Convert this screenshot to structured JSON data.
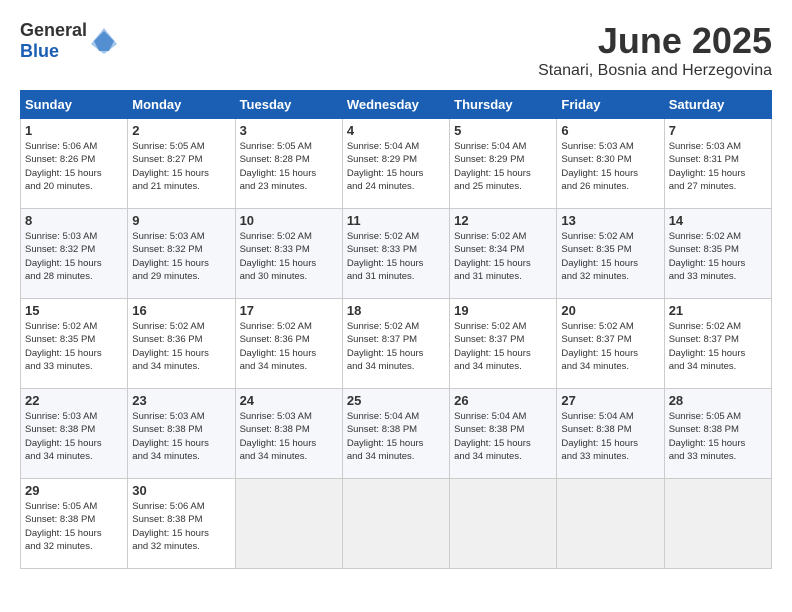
{
  "header": {
    "logo_general": "General",
    "logo_blue": "Blue",
    "title": "June 2025",
    "subtitle": "Stanari, Bosnia and Herzegovina"
  },
  "calendar": {
    "days_of_week": [
      "Sunday",
      "Monday",
      "Tuesday",
      "Wednesday",
      "Thursday",
      "Friday",
      "Saturday"
    ],
    "weeks": [
      [
        null,
        null,
        null,
        null,
        null,
        null,
        null
      ]
    ],
    "cells": [
      {
        "day": 1,
        "col": 0,
        "sunrise": "5:06 AM",
        "sunset": "8:26 PM",
        "daylight": "15 hours and 20 minutes."
      },
      {
        "day": 2,
        "col": 1,
        "sunrise": "5:05 AM",
        "sunset": "8:27 PM",
        "daylight": "15 hours and 21 minutes."
      },
      {
        "day": 3,
        "col": 2,
        "sunrise": "5:05 AM",
        "sunset": "8:28 PM",
        "daylight": "15 hours and 23 minutes."
      },
      {
        "day": 4,
        "col": 3,
        "sunrise": "5:04 AM",
        "sunset": "8:29 PM",
        "daylight": "15 hours and 24 minutes."
      },
      {
        "day": 5,
        "col": 4,
        "sunrise": "5:04 AM",
        "sunset": "8:29 PM",
        "daylight": "15 hours and 25 minutes."
      },
      {
        "day": 6,
        "col": 5,
        "sunrise": "5:03 AM",
        "sunset": "8:30 PM",
        "daylight": "15 hours and 26 minutes."
      },
      {
        "day": 7,
        "col": 6,
        "sunrise": "5:03 AM",
        "sunset": "8:31 PM",
        "daylight": "15 hours and 27 minutes."
      },
      {
        "day": 8,
        "col": 0,
        "sunrise": "5:03 AM",
        "sunset": "8:32 PM",
        "daylight": "15 hours and 28 minutes."
      },
      {
        "day": 9,
        "col": 1,
        "sunrise": "5:03 AM",
        "sunset": "8:32 PM",
        "daylight": "15 hours and 29 minutes."
      },
      {
        "day": 10,
        "col": 2,
        "sunrise": "5:02 AM",
        "sunset": "8:33 PM",
        "daylight": "15 hours and 30 minutes."
      },
      {
        "day": 11,
        "col": 3,
        "sunrise": "5:02 AM",
        "sunset": "8:33 PM",
        "daylight": "15 hours and 31 minutes."
      },
      {
        "day": 12,
        "col": 4,
        "sunrise": "5:02 AM",
        "sunset": "8:34 PM",
        "daylight": "15 hours and 31 minutes."
      },
      {
        "day": 13,
        "col": 5,
        "sunrise": "5:02 AM",
        "sunset": "8:35 PM",
        "daylight": "15 hours and 32 minutes."
      },
      {
        "day": 14,
        "col": 6,
        "sunrise": "5:02 AM",
        "sunset": "8:35 PM",
        "daylight": "15 hours and 33 minutes."
      },
      {
        "day": 15,
        "col": 0,
        "sunrise": "5:02 AM",
        "sunset": "8:35 PM",
        "daylight": "15 hours and 33 minutes."
      },
      {
        "day": 16,
        "col": 1,
        "sunrise": "5:02 AM",
        "sunset": "8:36 PM",
        "daylight": "15 hours and 34 minutes."
      },
      {
        "day": 17,
        "col": 2,
        "sunrise": "5:02 AM",
        "sunset": "8:36 PM",
        "daylight": "15 hours and 34 minutes."
      },
      {
        "day": 18,
        "col": 3,
        "sunrise": "5:02 AM",
        "sunset": "8:37 PM",
        "daylight": "15 hours and 34 minutes."
      },
      {
        "day": 19,
        "col": 4,
        "sunrise": "5:02 AM",
        "sunset": "8:37 PM",
        "daylight": "15 hours and 34 minutes."
      },
      {
        "day": 20,
        "col": 5,
        "sunrise": "5:02 AM",
        "sunset": "8:37 PM",
        "daylight": "15 hours and 34 minutes."
      },
      {
        "day": 21,
        "col": 6,
        "sunrise": "5:02 AM",
        "sunset": "8:37 PM",
        "daylight": "15 hours and 34 minutes."
      },
      {
        "day": 22,
        "col": 0,
        "sunrise": "5:03 AM",
        "sunset": "8:38 PM",
        "daylight": "15 hours and 34 minutes."
      },
      {
        "day": 23,
        "col": 1,
        "sunrise": "5:03 AM",
        "sunset": "8:38 PM",
        "daylight": "15 hours and 34 minutes."
      },
      {
        "day": 24,
        "col": 2,
        "sunrise": "5:03 AM",
        "sunset": "8:38 PM",
        "daylight": "15 hours and 34 minutes."
      },
      {
        "day": 25,
        "col": 3,
        "sunrise": "5:04 AM",
        "sunset": "8:38 PM",
        "daylight": "15 hours and 34 minutes."
      },
      {
        "day": 26,
        "col": 4,
        "sunrise": "5:04 AM",
        "sunset": "8:38 PM",
        "daylight": "15 hours and 34 minutes."
      },
      {
        "day": 27,
        "col": 5,
        "sunrise": "5:04 AM",
        "sunset": "8:38 PM",
        "daylight": "15 hours and 33 minutes."
      },
      {
        "day": 28,
        "col": 6,
        "sunrise": "5:05 AM",
        "sunset": "8:38 PM",
        "daylight": "15 hours and 33 minutes."
      },
      {
        "day": 29,
        "col": 0,
        "sunrise": "5:05 AM",
        "sunset": "8:38 PM",
        "daylight": "15 hours and 32 minutes."
      },
      {
        "day": 30,
        "col": 1,
        "sunrise": "5:06 AM",
        "sunset": "8:38 PM",
        "daylight": "15 hours and 32 minutes."
      }
    ],
    "label_sunrise": "Sunrise:",
    "label_sunset": "Sunset:",
    "label_daylight": "Daylight:"
  }
}
